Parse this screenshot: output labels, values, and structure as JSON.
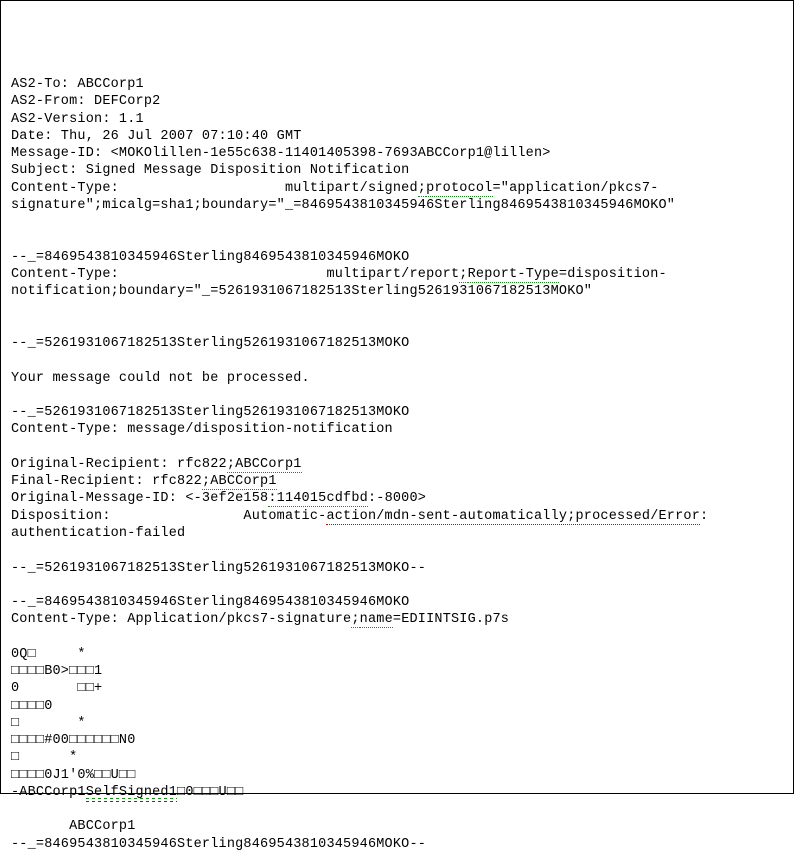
{
  "doc": {
    "header1": "AS2-To: ABCCorp1",
    "header2": "AS2-From: DEFCorp2",
    "header3": "AS2-Version: 1.1",
    "header4": "Date: Thu, 26 Jul 2007 07:10:40 GMT",
    "header5": "Message-ID: <MOKOlillen-1e55c638-11401405398-7693ABCCorp1@lillen>",
    "header6": "Subject: Signed Message Disposition Notification",
    "ct1_a": "Content-Type:                    multipart/signed",
    "ct1_semi": ";",
    "ct1_proto": "protocol",
    "ct1_b": "=\"application/pkcs7-signature\";micalg=sha1;boundary=\"_=8469543810345946Sterling8469543810345946MOKO\"",
    "boundary1": "--_=8469543810345946Sterling8469543810345946MOKO",
    "ct2_a": "Content-Type:                         multipart/report",
    "ct2_semi": ";",
    "ct2_rt": "Report-Type",
    "ct2_b": "=disposition-notification;boundary=\"_=5261931067182513Sterling5261931067182513MOKO\"",
    "boundary2": "--_=5261931067182513Sterling5261931067182513MOKO",
    "body1": "Your message could not be processed.",
    "boundary3": "--_=5261931067182513Sterling5261931067182513MOKO",
    "ct3": "Content-Type: message/disposition-notification",
    "orig_rcpt_a": "Original-Recipient: rfc822",
    "orig_rcpt_b": ";ABCCorp1",
    "final_rcpt_a": "Final-Recipient: rfc822",
    "final_rcpt_b": ";ABCCorp1",
    "orig_msgid_a": "Original-Message-ID: <-3ef2e158",
    "orig_msgid_b": ":114015cdfbd",
    "orig_msgid_c": ":-8000>",
    "disp_a": "Disposition:                Automatic-",
    "disp_b": "action/mdn-sent-automatically;processed/Error",
    "disp_c": ": authentication-failed",
    "boundary4": "--_=5261931067182513Sterling5261931067182513MOKO--",
    "boundary5": "--_=8469543810345946Sterling8469543810345946MOKO",
    "ct4_a": "Content-Type: Application/pkcs7-signature",
    "ct4_semi": ";",
    "ct4_name": "name",
    "ct4_b": "=EDIINTSIG.p7s",
    "bin1": "0Q□     *",
    "bin2": "□□□□B0>□□□1",
    "bin3": "0       □□+",
    "bin4": "□□□□0",
    "bin5": "□       *",
    "bin6": "□□□□#00□□□□□□N0",
    "bin7": "□      *",
    "bin8": "□□□□0J1'0%□□U□□",
    "self_a": "-ABCCorp1",
    "self_b": "SelfSigned1",
    "self_c": "□0□□□U□□",
    "bin9": "       ABCCorp1",
    "boundary6": "--_=8469543810345946Sterling8469543810345946MOKO--"
  }
}
